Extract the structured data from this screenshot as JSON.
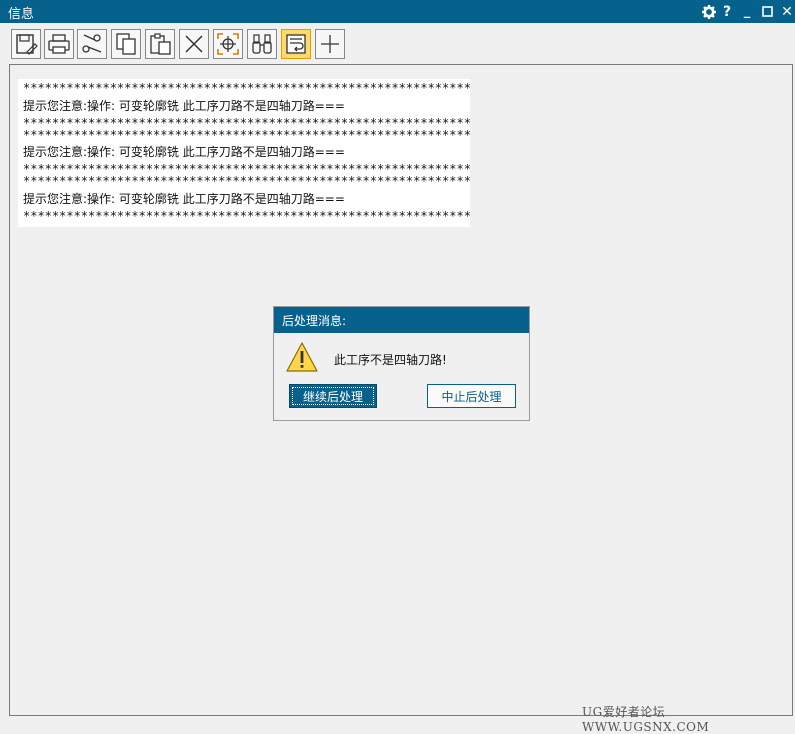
{
  "window": {
    "title": "信息",
    "controls": {
      "settings": "gear-icon",
      "help": "?",
      "minimize": "_",
      "maximize": "□",
      "close": "✕"
    }
  },
  "toolbar": {
    "buttons": [
      "save",
      "print",
      "cut",
      "copy",
      "paste",
      "clear",
      "locate",
      "find",
      "wrap",
      "add"
    ],
    "active": "wrap"
  },
  "info_lines": [
    "***************************************************************",
    "提示您注意:操作: 可变轮廓铣 此工序刀路不是四轴刀路===",
    "***************************************************************",
    "***************************************************************",
    "提示您注意:操作: 可变轮廓铣 此工序刀路不是四轴刀路===",
    "***************************************************************",
    "***************************************************************",
    "提示您注意:操作: 可变轮廓铣 此工序刀路不是四轴刀路===",
    "***************************************************************"
  ],
  "dialog": {
    "title": "后处理消息:",
    "message": "此工序不是四轴刀路!",
    "continue_label": "继续后处理",
    "abort_label": "中止后处理"
  },
  "watermark": "UG爱好者论坛 WWW.UGSNX.COM"
}
